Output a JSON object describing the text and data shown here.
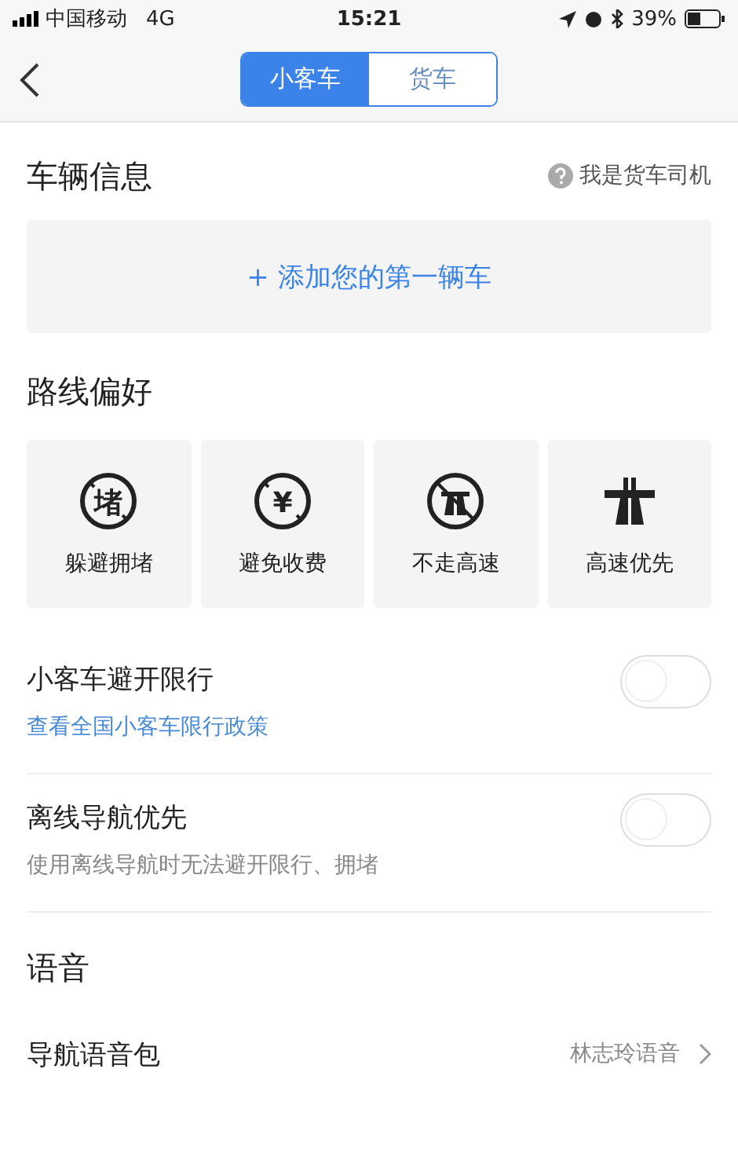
{
  "status_bar": {
    "carrier": "中国移动",
    "network": "4G",
    "time": "15:21",
    "battery": "39%"
  },
  "header": {
    "tabs": [
      {
        "label": "小客车",
        "selected": true
      },
      {
        "label": "货车",
        "selected": false
      }
    ]
  },
  "vehicle": {
    "title": "车辆信息",
    "help": "我是货车司机",
    "add_button": "+ 添加您的第一辆车"
  },
  "route": {
    "title": "路线偏好",
    "options": [
      {
        "kind": "no-char",
        "glyph": "堵",
        "label": "躲避拥堵"
      },
      {
        "kind": "no-char",
        "glyph": "¥",
        "label": "避免收费"
      },
      {
        "kind": "no-highway",
        "label": "不走高速"
      },
      {
        "kind": "highway",
        "label": "高速优先"
      }
    ]
  },
  "toggles": [
    {
      "label": "小客车避开限行",
      "note": "查看全国小客车限行政策",
      "kind": "link",
      "on": false
    },
    {
      "label": "离线导航优先",
      "note": "使用离线导航时无法避开限行、拥堵",
      "kind": "text",
      "on": false
    }
  ],
  "voice": {
    "title": "语音",
    "rows": [
      {
        "label": "导航语音包",
        "value": "林志玲语音"
      }
    ]
  }
}
